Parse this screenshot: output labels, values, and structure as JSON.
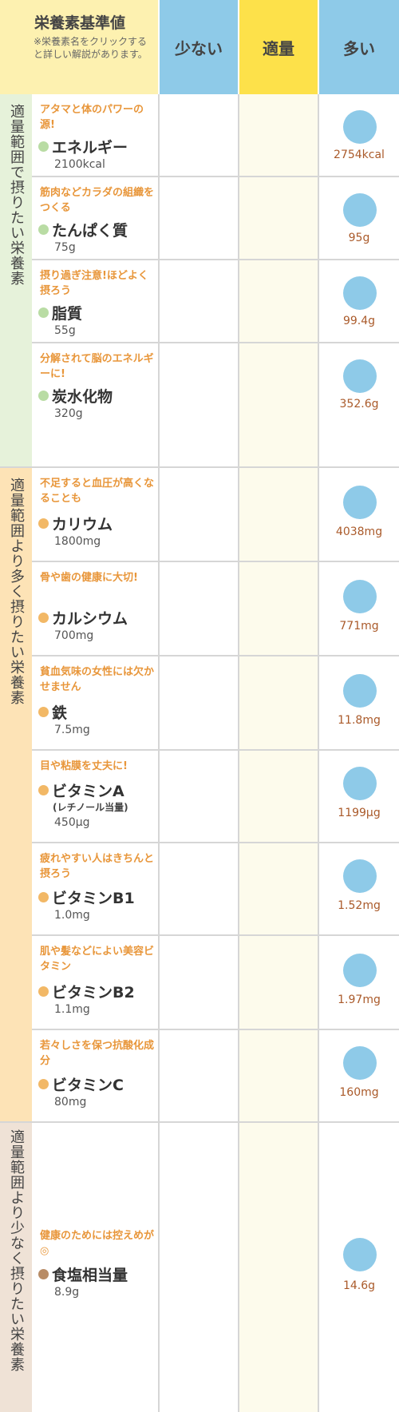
{
  "header": {
    "standard_title": "栄養素基準値",
    "standard_note": "※栄養素名をクリックすると詳しい解説があります。",
    "col_few": "少ない",
    "col_appropriate": "適量",
    "col_many": "多い"
  },
  "categories": [
    {
      "label": "適量範囲で摂りたい栄養素",
      "color": "#e6f2da"
    },
    {
      "label": "適量範囲より多く摂りたい栄養素",
      "color": "#fde3b6"
    },
    {
      "label": "適量範囲より少なく摂りたい栄養素",
      "color": "#efe2d6"
    }
  ],
  "nutrients": [
    {
      "tagline": "アタマと体のパワーの源!",
      "name": "エネルギー",
      "sub": "",
      "standard": "2100kcal",
      "amount": "2754kcal",
      "level": "多い"
    },
    {
      "tagline": "筋肉などカラダの組織をつくる",
      "name": "たんぱく質",
      "sub": "",
      "standard": "75g",
      "amount": "95g",
      "level": "多い"
    },
    {
      "tagline": "摂り過ぎ注意!ほどよく摂ろう",
      "name": "脂質",
      "sub": "",
      "standard": "55g",
      "amount": "99.4g",
      "level": "多い"
    },
    {
      "tagline": "分解されて脳のエネルギーに!",
      "name": "炭水化物",
      "sub": "",
      "standard": "320g",
      "amount": "352.6g",
      "level": "多い"
    },
    {
      "tagline": "不足すると血圧が高くなることも",
      "name": "カリウム",
      "sub": "",
      "standard": "1800mg",
      "amount": "4038mg",
      "level": "多い"
    },
    {
      "tagline": "骨や歯の健康に大切!",
      "name": "カルシウム",
      "sub": "",
      "standard": "700mg",
      "amount": "771mg",
      "level": "多い"
    },
    {
      "tagline": "貧血気味の女性には欠かせません",
      "name": "鉄",
      "sub": "",
      "standard": "7.5mg",
      "amount": "11.8mg",
      "level": "多い"
    },
    {
      "tagline": "目や粘膜を丈夫に!",
      "name": "ビタミンA",
      "sub": "(レチノール当量)",
      "standard": "450μg",
      "amount": "1199μg",
      "level": "多い"
    },
    {
      "tagline": "疲れやすい人はきちんと摂ろう",
      "name": "ビタミンB1",
      "sub": "",
      "standard": "1.0mg",
      "amount": "1.52mg",
      "level": "多い"
    },
    {
      "tagline": "肌や髪などによい美容ビタミン",
      "name": "ビタミンB2",
      "sub": "",
      "standard": "1.1mg",
      "amount": "1.97mg",
      "level": "多い"
    },
    {
      "tagline": "若々しさを保つ抗酸化成分",
      "name": "ビタミンC",
      "sub": "",
      "standard": "80mg",
      "amount": "160mg",
      "level": "多い"
    },
    {
      "tagline": "健康のためには控えめが◎",
      "name": "食塩相当量",
      "sub": "",
      "standard": "8.9g",
      "amount": "14.6g",
      "level": "多い"
    }
  ],
  "colors": {
    "header_yellow": "#fdf1b0",
    "header_blue": "#8ecae8",
    "header_gold": "#fde14a",
    "tagline_orange": "#e8963a",
    "amount_brown": "#aa5a2a",
    "dot_green": "#b9dca4",
    "dot_orange": "#f2b866",
    "dot_brown": "#b88c66",
    "indicator_circle": "#8ecae8"
  }
}
